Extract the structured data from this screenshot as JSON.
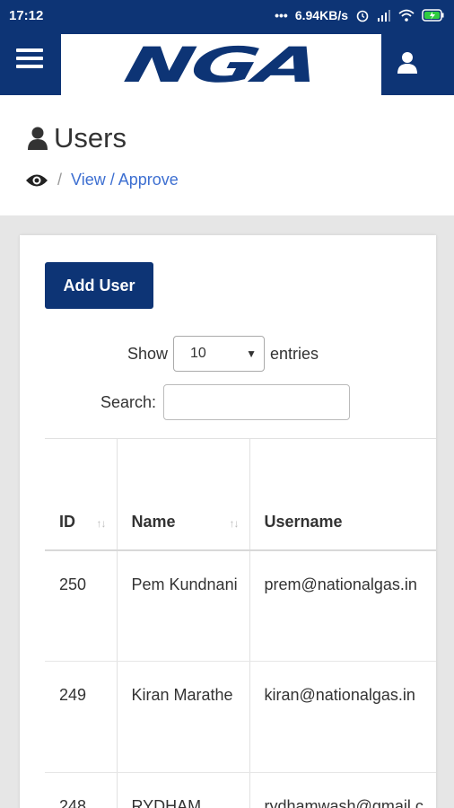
{
  "status_bar": {
    "time": "17:12",
    "network_speed": "6.94KB/s",
    "icons": [
      "dots-icon",
      "alarm-icon",
      "signal-icon",
      "wifi-icon",
      "battery-charging-icon"
    ]
  },
  "app_bar": {
    "logo": "NGA",
    "menu_icon": "hamburger-menu-icon",
    "user_icon": "user-icon"
  },
  "page": {
    "title": "Users",
    "breadcrumb": {
      "separator": "/",
      "link": "View / Approve"
    }
  },
  "toolbar": {
    "add_user_label": "Add User"
  },
  "table_controls": {
    "show_label": "Show",
    "entries_value": "10",
    "entries_label": "entries",
    "search_label": "Search:",
    "search_value": ""
  },
  "table": {
    "columns": [
      "ID",
      "Name",
      "Username"
    ],
    "rows": [
      {
        "id": "250",
        "name": "Pem Kundnani",
        "username": "prem@nationalgas.in"
      },
      {
        "id": "249",
        "name": "Kiran Marathe",
        "username": "kiran@nationalgas.in"
      },
      {
        "id": "248",
        "name": "RYDHAM",
        "username": "rydhamwash@gmail.c"
      }
    ]
  },
  "colors": {
    "brand": "#0d3475",
    "link": "#3d6fd1",
    "background": "#e6e6e6"
  }
}
